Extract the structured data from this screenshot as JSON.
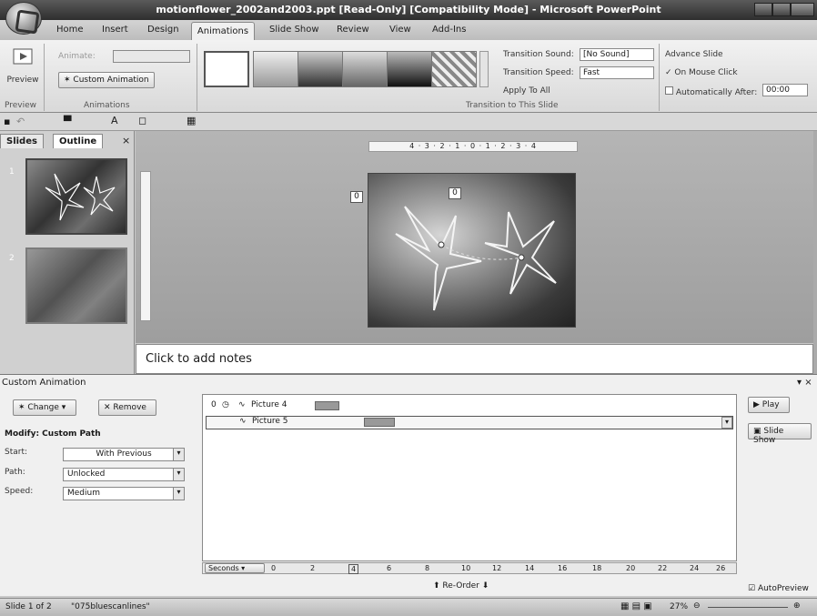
{
  "window": {
    "title": "motionflower_2002and2003.ppt [Read-Only] [Compatibility Mode] - Microsoft PowerPoint"
  },
  "ribbon": {
    "tabs": [
      "Home",
      "Insert",
      "Design",
      "Animations",
      "Slide Show",
      "Review",
      "View",
      "Add-Ins"
    ],
    "active_tab": "Animations",
    "preview_label": "Preview",
    "animate_label": "Animate:",
    "custom_animation_label": "Custom Animation",
    "group_preview": "Preview",
    "group_animations": "Animations",
    "transition_sound_label": "Transition Sound:",
    "transition_sound_value": "[No Sound]",
    "transition_speed_label": "Transition Speed:",
    "transition_speed_value": "Fast",
    "apply_to_all_label": "Apply To All",
    "group_transition": "Transition to This Slide",
    "advance_slide_label": "Advance Slide",
    "on_mouse_click_label": "On Mouse Click",
    "on_mouse_click_checked": true,
    "auto_after_label": "Automatically After:",
    "auto_after_value": "00:00"
  },
  "slides_pane": {
    "tab_slides": "Slides",
    "tab_outline": "Outline",
    "close": "×",
    "slide_numbers": [
      "1",
      "2"
    ]
  },
  "editor": {
    "ruler_text": "4 · 3 · 2 · 1 · 0 · 1 · 2 · 3 · 4",
    "tag_outside": "0",
    "tag_inside": "0",
    "notes_placeholder": "Click to add notes"
  },
  "custom_animation": {
    "title": "Custom Animation",
    "change_label": "Change",
    "remove_label": "Remove",
    "modify_heading": "Modify: Custom Path",
    "start_label": "Start:",
    "start_value": "With Previous",
    "path_label": "Path:",
    "path_value": "Unlocked",
    "speed_label": "Speed:",
    "speed_value": "Medium",
    "items": [
      {
        "order": "0",
        "name": "Picture 4"
      },
      {
        "order": "",
        "name": "Picture 5"
      }
    ],
    "seconds_label": "Seconds",
    "timeline_ticks": [
      "0",
      "2",
      "4",
      "6",
      "8",
      "10",
      "12",
      "14",
      "16",
      "18",
      "20",
      "22",
      "24",
      "26"
    ],
    "reorder_label": "Re-Order",
    "play_label": "Play",
    "slideshow_label": "Slide Show",
    "autopreview_label": "AutoPreview",
    "autopreview_checked": true
  },
  "status": {
    "slide_info": "Slide 1 of 2",
    "theme": "\"075bluescanlines\"",
    "zoom": "27%"
  }
}
